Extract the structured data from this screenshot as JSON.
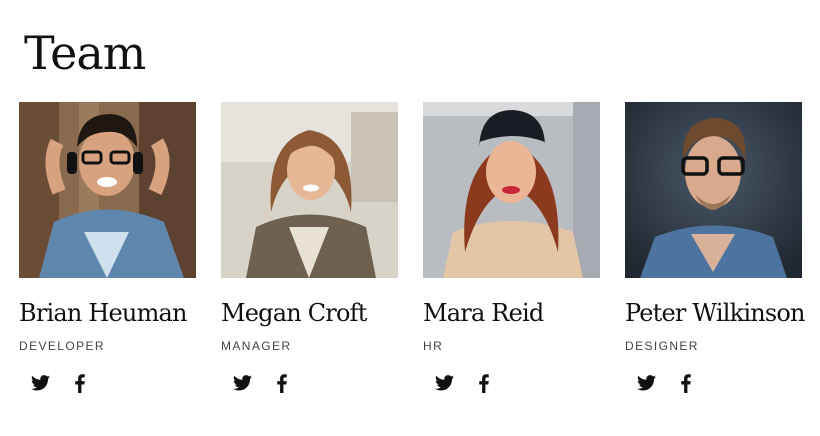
{
  "page": {
    "title": "Team"
  },
  "members": [
    {
      "name": "Brian Heuman",
      "role": "DEVELOPER",
      "photo_icon": "portrait-photo"
    },
    {
      "name": "Megan Croft",
      "role": "MANAGER",
      "photo_icon": "portrait-photo"
    },
    {
      "name": "Mara Reid",
      "role": "HR",
      "photo_icon": "portrait-photo"
    },
    {
      "name": "Peter Wilkinson",
      "role": "DESIGNER",
      "photo_icon": "portrait-photo"
    }
  ],
  "social": {
    "icons": [
      "twitter-icon",
      "facebook-icon"
    ]
  },
  "colors": {
    "text": "#111111",
    "role_text": "#444444",
    "icon": "#111111",
    "background": "#ffffff"
  }
}
